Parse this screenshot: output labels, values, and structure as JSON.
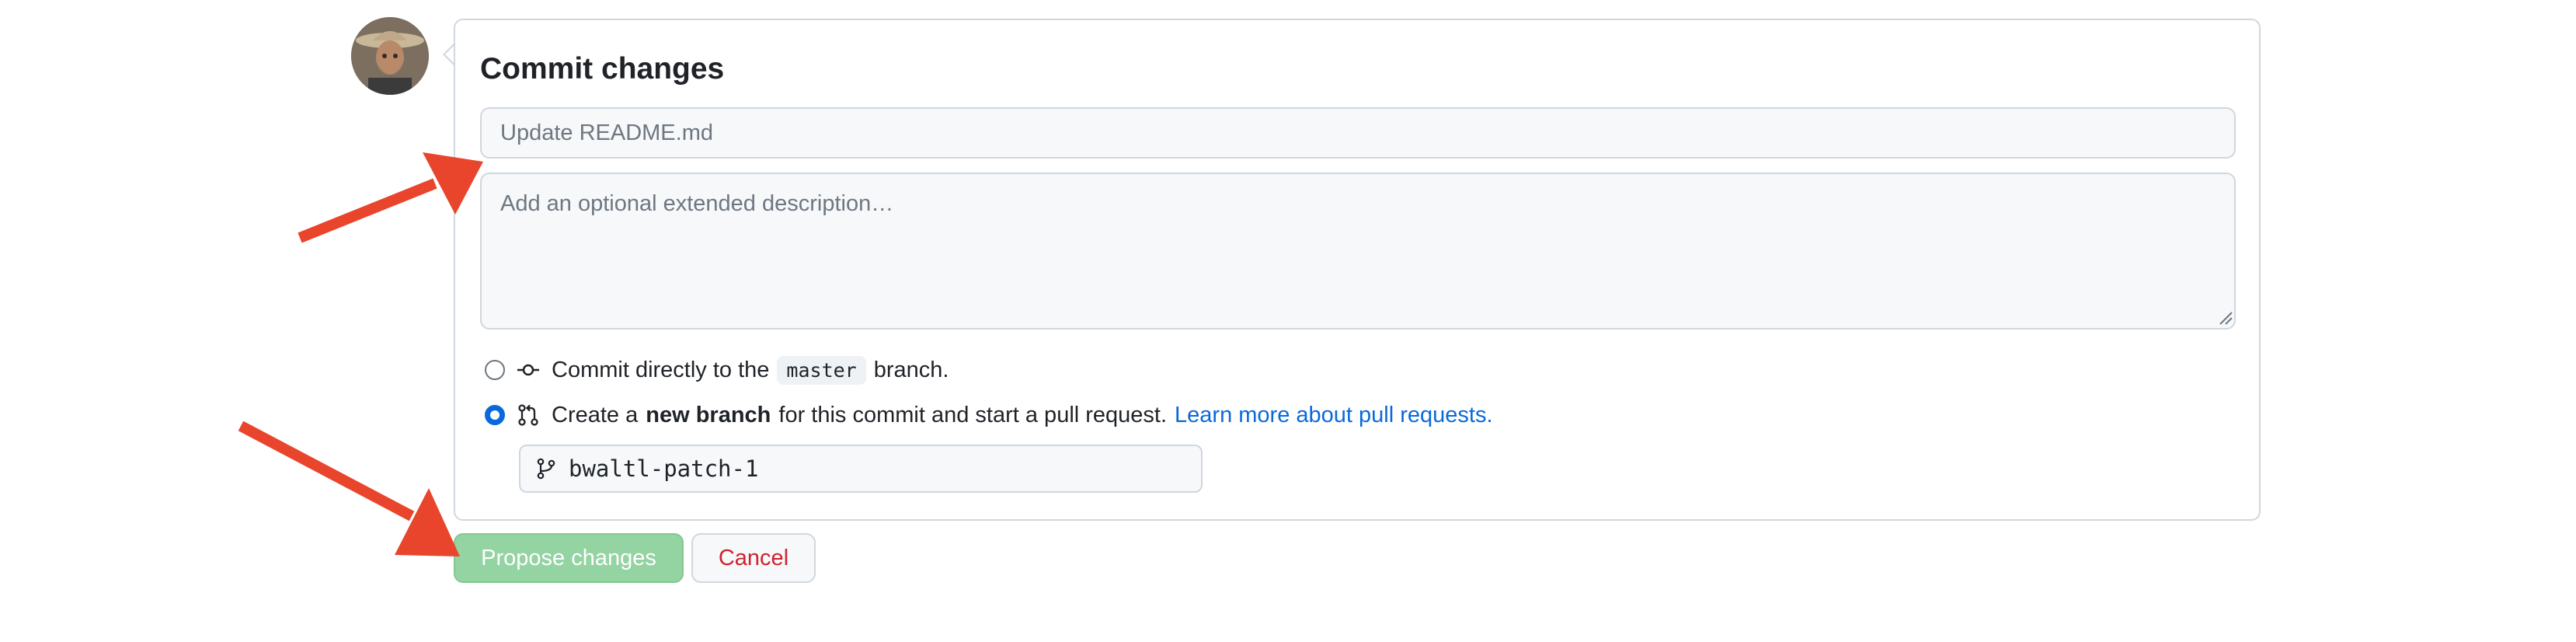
{
  "commit": {
    "title": "Commit changes",
    "summary_placeholder": "Update README.md",
    "summary_value": "",
    "description_placeholder": "Add an optional extended description…",
    "description_value": ""
  },
  "options": {
    "direct": {
      "selected": false,
      "prefix": "Commit directly to the",
      "branch": "master",
      "suffix": "branch."
    },
    "new_branch": {
      "selected": true,
      "prefix": "Create a",
      "bold": "new branch",
      "suffix": "for this commit and start a pull request.",
      "link_label": "Learn more about pull requests."
    }
  },
  "branch_name": {
    "value": "bwaltl-patch-1"
  },
  "actions": {
    "propose_label": "Propose changes",
    "cancel_label": "Cancel"
  },
  "icons": {
    "avatar": "user-avatar",
    "commit": "git-commit-icon",
    "pull_request": "git-pull-request-icon",
    "branch": "git-branch-icon"
  },
  "colors": {
    "accent": "#0969da",
    "propose_button": "#94d3a2",
    "cancel_text": "#cf222e",
    "annotation_arrow": "#e8452c"
  }
}
